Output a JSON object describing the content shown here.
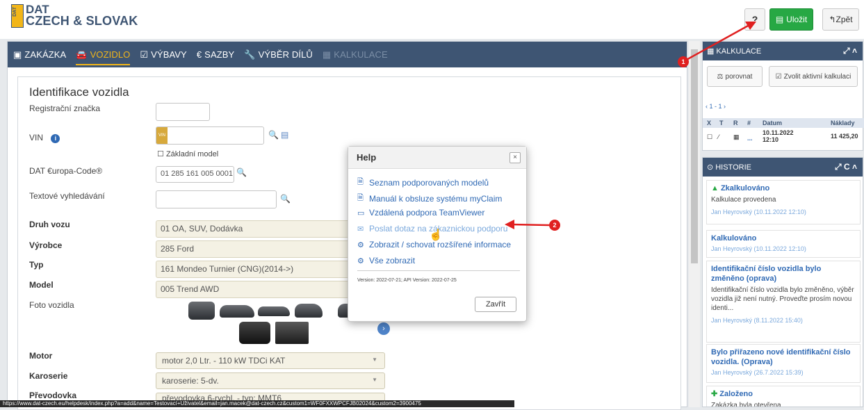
{
  "header": {
    "logo_top": "DAT",
    "logo_bottom": "CZECH & SLOVAK",
    "logo_mark": "DAT",
    "help_label": "?",
    "save_label": "Uložit",
    "back_label": "Zpět"
  },
  "tabs": [
    {
      "label": "ZAKÁZKA"
    },
    {
      "label": "VOZIDLO"
    },
    {
      "label": "VÝBAVY"
    },
    {
      "label": "SAZBY"
    },
    {
      "label": "VÝBĚR DÍLŮ"
    },
    {
      "label": "KALKULACE"
    }
  ],
  "form": {
    "title": "Identifikace vozidla",
    "labels": {
      "reg": "Registrační značka",
      "vin": "VIN",
      "zakladni_model": "Základní model",
      "europa_code": "DAT €uropa-Code®",
      "text_search": "Textové vyhledávání",
      "druh": "Druh vozu",
      "vyrobce": "Výrobce",
      "typ": "Typ",
      "model": "Model",
      "foto": "Foto vozidla",
      "motor": "Motor",
      "karoserie": "Karoserie",
      "prevodovka": "Převodovka"
    },
    "values": {
      "vin_prefix": "VIN",
      "europa_code": "01 285 161 005 0001",
      "druh": "01 OA, SUV, Dodávka",
      "vyrobce": "285 Ford",
      "typ": "161 Mondeo Turnier (CNG)(2014->)",
      "model": "005 Trend AWD",
      "motor": "motor 2,0 Ltr. - 110 kW TDCi KAT",
      "karoserie": "karoserie: 5-dv.",
      "prevodovka": "převodovka 6-rychl. - typ: MMT6"
    }
  },
  "help_dialog": {
    "title": "Help",
    "close": "×",
    "links": [
      "Seznam podporovaných modelů",
      "Manuál k obsluze systému myClaim",
      "Vzdálená podpora TeamViewer",
      "Poslat dotaz na zákaznickou podporu",
      "Zobrazit / schovat rozšířené informace",
      "Vše zobrazit"
    ],
    "version": "Version: 2022-07-21; API Version: 2022-07-25",
    "close_button": "Zavřít"
  },
  "kalkulace": {
    "title": "KALKULACE",
    "compare_btn": "porovnat",
    "select_btn": "Zvolit aktivní kalkulaci",
    "pager": "1 - 1",
    "columns": [
      "X",
      "T",
      "R",
      "#",
      "Datum",
      "Náklady"
    ],
    "row": {
      "dots": "...",
      "date": "10.11.2022",
      "time": "12:10",
      "cost": "11 425,20"
    }
  },
  "historie": {
    "title": "HISTORIE",
    "items": [
      {
        "title": "Zkalkulováno",
        "desc": "Kalkulace provedena",
        "meta": "Jan Heyrovský (10.11.2022 12:10)"
      },
      {
        "title": "Kalkulováno",
        "desc": "",
        "meta": "Jan Heyrovský (10.11.2022 12:10)"
      },
      {
        "title": "Identifikační číslo vozidla bylo změněno (oprava)",
        "desc": "Identifikační číslo vozidla bylo změněno, výběr vozidla již není nutný. Proveďte prosím novou identi...",
        "meta": "Jan Heyrovský (8.11.2022 15:40)"
      },
      {
        "title": "Bylo přiřazeno nové identifikační číslo vozidla. (Oprava)",
        "desc": "",
        "meta": "Jan Heyrovský (26.7.2022 15:39)"
      },
      {
        "title": "Založeno",
        "desc": "Zakázka byla otevřena",
        "meta": ""
      }
    ]
  },
  "annotations": {
    "badge1": "1",
    "badge2": "2"
  },
  "statusbar": "https://www.dat-czech.eu/helpdesk/index.php?a=add&name=Testovací+Uživatel&email=jan.macek@dat-czech.cz&custom1=WF0FXXWPCFJB02024&custom2=3900475",
  "colors": {
    "nav": "#3e5573",
    "accent": "#f2b619",
    "save": "#27a844",
    "link": "#2f69b4",
    "annotation": "#e02020"
  }
}
